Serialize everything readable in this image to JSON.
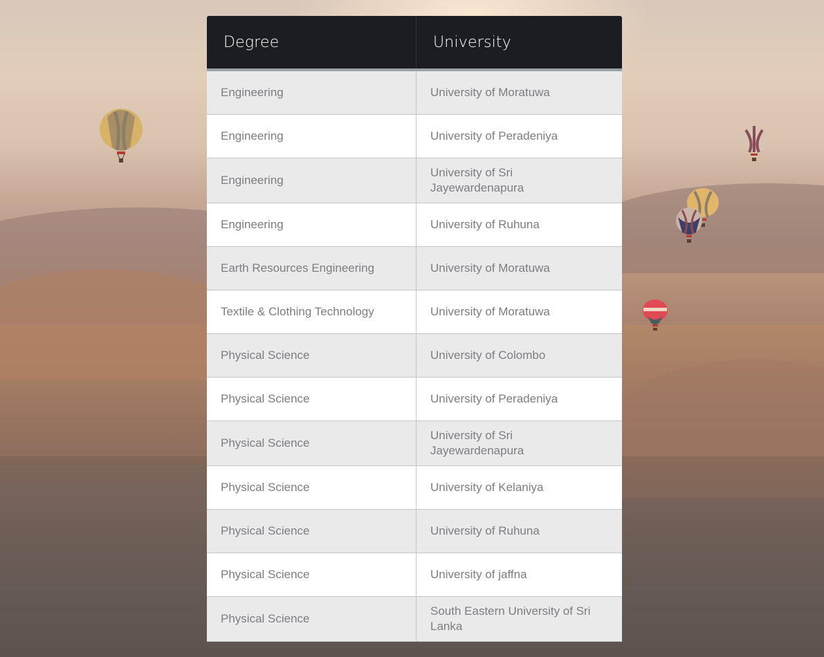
{
  "table": {
    "headers": [
      "Degree",
      "University"
    ],
    "rows": [
      [
        "Engineering",
        "University of Moratuwa"
      ],
      [
        "Engineering",
        "University of Peradeniya"
      ],
      [
        "Engineering",
        "University of Sri Jayewardenapura"
      ],
      [
        "Engineering",
        "University of Ruhuna"
      ],
      [
        "Earth Resources Engineering",
        "University of Moratuwa"
      ],
      [
        "Textile & Clothing Technology",
        "University of Moratuwa"
      ],
      [
        "Physical Science",
        "University of Colombo"
      ],
      [
        "Physical Science",
        "University of Peradeniya"
      ],
      [
        "Physical Science",
        "University of Sri Jayewardenapura"
      ],
      [
        "Physical Science",
        "University of Kelaniya"
      ],
      [
        "Physical Science",
        "University of Ruhuna"
      ],
      [
        "Physical Science",
        "University of jaffna"
      ],
      [
        "Physical Science",
        "South Eastern University of Sri Lanka"
      ]
    ]
  },
  "colors": {
    "header_bg": "#1c1d22",
    "header_text": "#ffffff",
    "row_odd": "#eaeaea",
    "row_even": "#ffffff",
    "cell_text": "#7c7d83"
  }
}
